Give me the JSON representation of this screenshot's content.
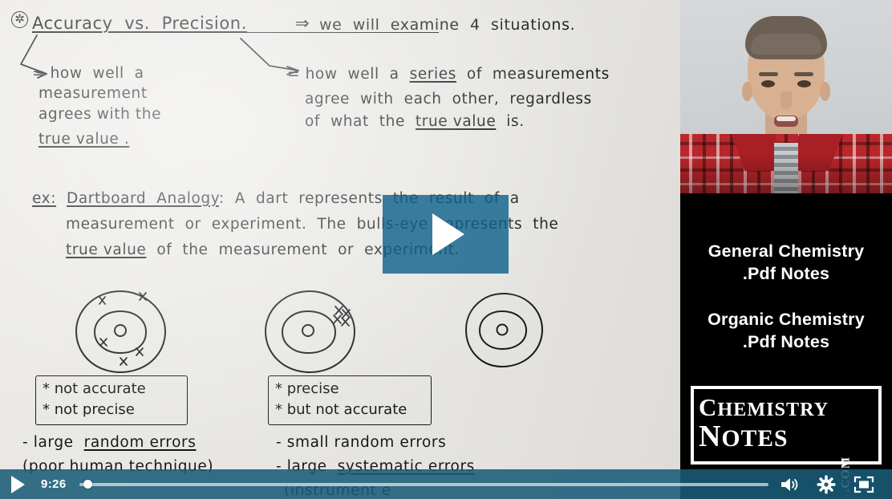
{
  "board": {
    "heading": "Accuracy  vs.  Precision.",
    "heading_arrow": "⇒",
    "heading_note": "we  will  examine  4  situations.",
    "accuracy_def": [
      "= how  well  a",
      "measurement",
      "agrees with the",
      "true value ."
    ],
    "accuracy_def_underlined": "true value",
    "precision_def": [
      "= how  well  a  series  of  measurements",
      "agree  with  each  other,  regardless",
      "of  what  the  true value  is."
    ],
    "precision_def_underlined_1": "series",
    "precision_def_underlined_2": "true value",
    "example_label": "ex:",
    "example_title": "Dartboard  Analogy",
    "example_body": [
      "ex: Dartboard Analogy : A  dart  represents  the  result  of  a",
      "measurement  or  experiment.  The  bulls-eye  represents  the",
      "true value  of  the  measurement  or  experiment."
    ],
    "targets": [
      {
        "name": "target-1",
        "box_lines": [
          "* not accurate",
          "* not precise"
        ],
        "notes": [
          "- large  random errors",
          "(poor human technique)"
        ],
        "notes_underlined": "random errors",
        "marks": 5
      },
      {
        "name": "target-2",
        "box_lines": [
          "* precise",
          "* but not accurate"
        ],
        "notes": [
          "- small random errors",
          "- large  systematic errors",
          "(instrument e"
        ],
        "notes_underlined": "systematic errors",
        "marks": 4
      },
      {
        "name": "target-3",
        "box_lines": [],
        "notes": [],
        "marks": 0
      }
    ]
  },
  "rail": {
    "notes_block_1": [
      "General Chemistry",
      ".Pdf Notes"
    ],
    "notes_block_2": [
      "Organic Chemistry",
      ".Pdf Notes"
    ],
    "logo": {
      "line1_first": "C",
      "line1_rest": "HEMISTRY",
      "line2_first": "N",
      "line2_rest": "OTES",
      "tld": ".COM"
    }
  },
  "player": {
    "play_overlay_icon": "play-triangle-icon",
    "controls": {
      "play_icon": "play-icon",
      "current_time": "9:26",
      "progress_percent": 0.5,
      "volume_icon": "volume-icon",
      "settings_icon": "gear-icon",
      "fullscreen_icon": "fullscreen-icon"
    },
    "accent_color": "#0b5f89",
    "control_bar_color": "#195c78"
  }
}
